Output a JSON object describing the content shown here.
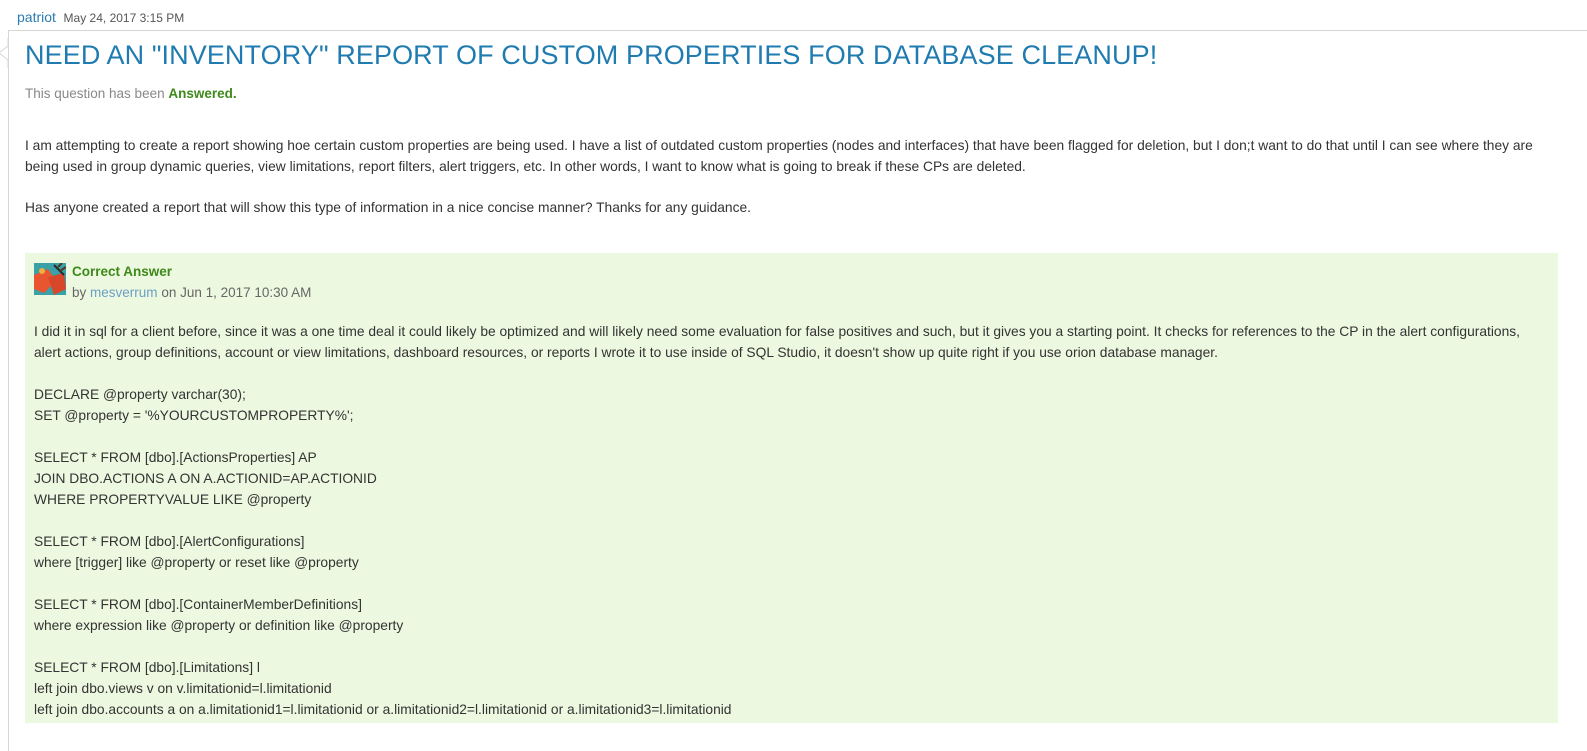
{
  "post": {
    "author": "patriot",
    "date": "May 24, 2017 3:15 PM",
    "title": "NEED AN \"INVENTORY\" REPORT OF CUSTOM PROPERTIES FOR DATABASE CLEANUP!",
    "status_prefix": "This question has been",
    "status_value": "Answered.",
    "body": [
      "I am attempting to create a report showing hoe certain custom properties are being used. I have a list of outdated custom properties (nodes and interfaces) that have been flagged for deletion, but I don;t want to do that until I can see where they are being used in group dynamic queries, view limitations, report filters, alert triggers, etc. In other words, I want to know what is going to break if these CPs are deleted.",
      "Has anyone created a report that will show this type of information in a nice concise manner? Thanks for any guidance."
    ]
  },
  "answer": {
    "label": "Correct Answer",
    "by_prefix": "by",
    "user": "mesverrum",
    "on_text": "on Jun 1, 2017 10:30 AM",
    "intro": "I did it in sql for a client before, since it was a one time deal it could likely be optimized and will likely need some evaluation for false positives and such, but it gives you a starting point.  It checks for references to the CP in the alert configurations, alert actions, group definitions, account or view limitations, dashboard resources, or reports  I wrote it to use inside of SQL Studio, it doesn't show up quite right if you use orion database manager.",
    "code": [
      "DECLARE @property varchar(30);",
      "SET @property = '%YOURCUSTOMPROPERTY%';",
      "",
      "SELECT * FROM [dbo].[ActionsProperties] AP",
      "JOIN DBO.ACTIONS A ON A.ACTIONID=AP.ACTIONID",
      "WHERE PROPERTYVALUE LIKE @property",
      "",
      "SELECT * FROM [dbo].[AlertConfigurations]",
      "where [trigger] like @property or reset like @property",
      "",
      "SELECT * FROM [dbo].[ContainerMemberDefinitions]",
      "where expression like @property or definition like @property",
      "",
      "SELECT * FROM [dbo].[Limitations] l",
      "left join dbo.views v on v.limitationid=l.limitationid",
      "left join dbo.accounts a on a.limitationid1=l.limitationid or a.limitationid2=l.limitationid or a.limitationid3=l.limitationid"
    ]
  },
  "colors": {
    "title": "#1f7bb0",
    "answered": "#3d8a1b",
    "answer_bg": "#edf8e0",
    "user_link": "#6b9fc4"
  }
}
